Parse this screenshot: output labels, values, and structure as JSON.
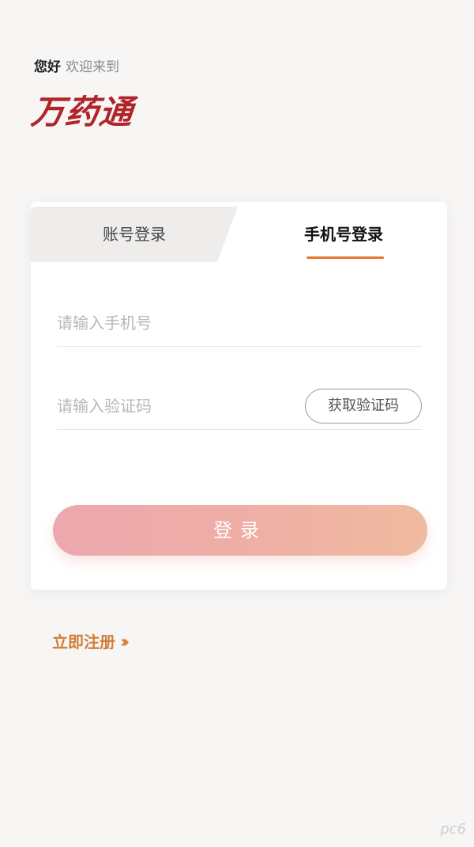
{
  "header": {
    "hello": "您好",
    "welcome": "欢迎来到",
    "logo_text": "万药通"
  },
  "tabs": {
    "account": "账号登录",
    "phone": "手机号登录",
    "active": "phone"
  },
  "form": {
    "phone_placeholder": "请输入手机号",
    "phone_value": "",
    "code_placeholder": "请输入验证码",
    "code_value": "",
    "get_code_label": "获取验证码",
    "login_label": "登录"
  },
  "register": {
    "label": "立即注册",
    "icon": "double-chevron-right-icon"
  },
  "watermark": {
    "text": "pc6"
  },
  "colors": {
    "brand": "#b0242a",
    "accent": "#e2772b",
    "button_start": "#eda7ae",
    "button_end": "#f0bba0"
  }
}
